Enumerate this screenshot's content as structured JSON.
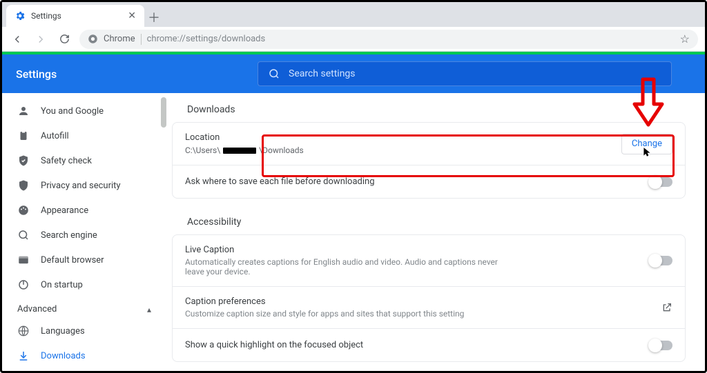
{
  "tab": {
    "title": "Settings"
  },
  "omnibox": {
    "prefix": "Chrome",
    "url": "chrome://settings/downloads"
  },
  "header": {
    "title": "Settings",
    "search_placeholder": "Search settings"
  },
  "sidebar": {
    "items": [
      {
        "label": "You and Google"
      },
      {
        "label": "Autofill"
      },
      {
        "label": "Safety check"
      },
      {
        "label": "Privacy and security"
      },
      {
        "label": "Appearance"
      },
      {
        "label": "Search engine"
      },
      {
        "label": "Default browser"
      },
      {
        "label": "On startup"
      }
    ],
    "advanced_label": "Advanced",
    "advanced_items": [
      {
        "label": "Languages"
      },
      {
        "label": "Downloads"
      }
    ]
  },
  "downloads": {
    "section_title": "Downloads",
    "location_label": "Location",
    "location_prefix": "C:\\Users\\",
    "location_suffix": "\\Downloads",
    "change_label": "Change",
    "ask_label": "Ask where to save each file before downloading"
  },
  "accessibility": {
    "section_title": "Accessibility",
    "live_caption_title": "Live Caption",
    "live_caption_desc": "Automatically creates captions for English audio and video. Audio and captions never leave your device.",
    "caption_pref_title": "Caption preferences",
    "caption_pref_desc": "Customize caption size and style for apps and sites that support this setting",
    "highlight_label": "Show a quick highlight on the focused object"
  }
}
